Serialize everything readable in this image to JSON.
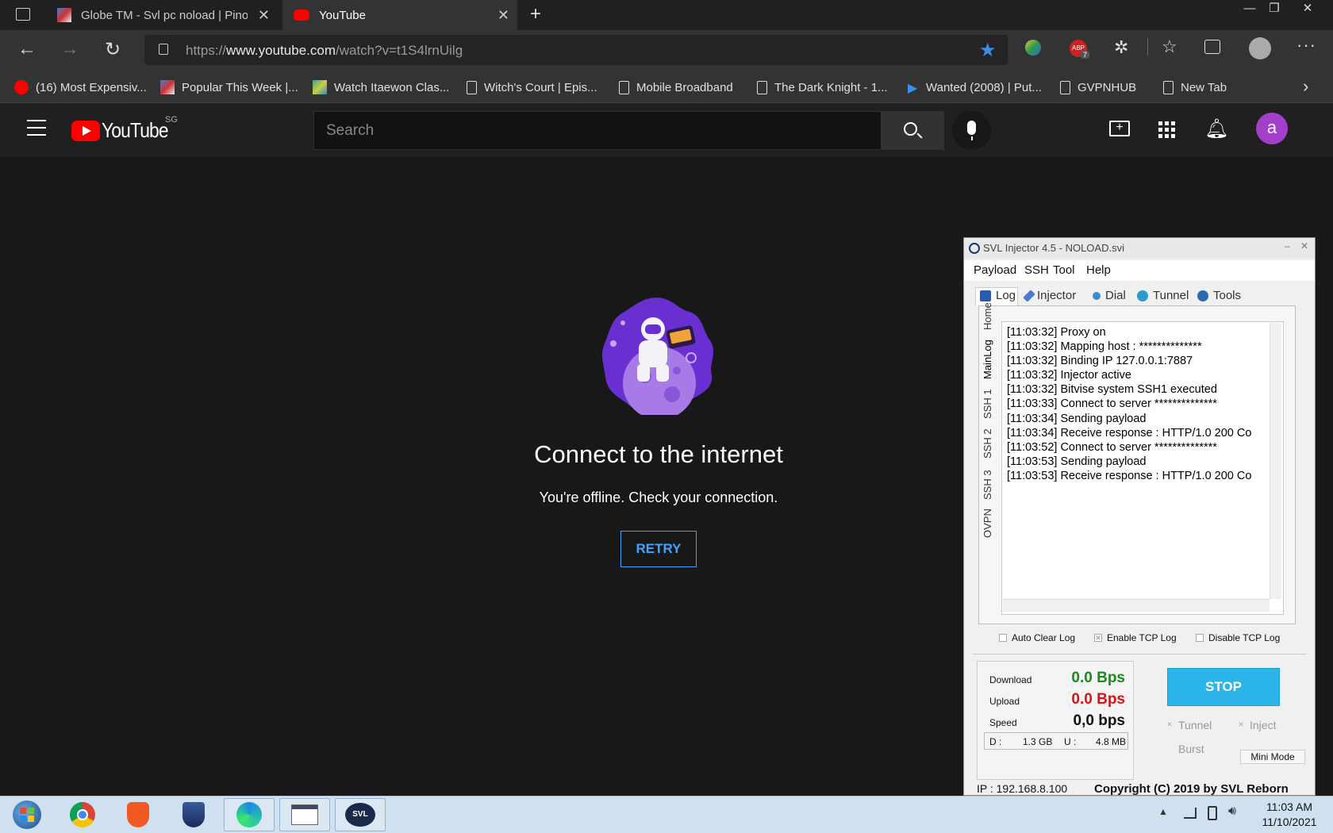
{
  "browser": {
    "tabs": [
      {
        "title": "Globe TM - Svl pc noload | Pinoy"
      },
      {
        "title": "YouTube"
      }
    ],
    "address": {
      "prefix": "https://",
      "host": "www.youtube.com",
      "path": "/watch?v=t1S4lrnUilg"
    },
    "bookmarks": [
      {
        "label": "(16) Most Expensiv..."
      },
      {
        "label": "Popular This Week |..."
      },
      {
        "label": "Watch Itaewon Clas..."
      },
      {
        "label": "Witch's Court | Epis..."
      },
      {
        "label": "Mobile Broadband"
      },
      {
        "label": "The Dark Knight - 1..."
      },
      {
        "label": "Wanted (2008) | Put..."
      },
      {
        "label": "GVPNHUB"
      },
      {
        "label": "New Tab"
      }
    ],
    "adblock_badge": "7"
  },
  "youtube": {
    "logo_text": "YouTube",
    "region": "SG",
    "search_placeholder": "Search",
    "avatar_letter": "a",
    "offline_title": "Connect to the internet",
    "offline_message": "You're offline. Check your connection.",
    "retry_label": "RETRY"
  },
  "svl": {
    "title": "SVL Injector 4.5 - NOLOAD.svi",
    "menu": [
      "Payload",
      "SSH",
      "Tool",
      "Help"
    ],
    "tabs": [
      "Log",
      "Injector",
      "Dial",
      "Tunnel",
      "Tools"
    ],
    "side_tabs": [
      "Home",
      "MainLog",
      "SSH 1",
      "SSH 2",
      "SSH 3",
      "OVPN"
    ],
    "log": [
      "[11:03:32] Proxy on",
      "[11:03:32] Mapping host : **************",
      "[11:03:32] Binding IP 127.0.0.1:7887",
      "[11:03:32] Injector active",
      "[11:03:32] Bitvise system SSH1 executed",
      "[11:03:33] Connect to server **************",
      "[11:03:34] Sending payload",
      "[11:03:34] Receive response : HTTP/1.0 200 Co",
      "[11:03:52] Connect to server **************",
      "[11:03:53] Sending payload",
      "[11:03:53] Receive response : HTTP/1.0 200 Co"
    ],
    "checkboxes": {
      "auto_clear": "Auto Clear Log",
      "enable_tcp": "Enable TCP Log",
      "disable_tcp": "Disable TCP Log"
    },
    "stats": {
      "download_label": "Download",
      "download_value": "0.0 Bps",
      "upload_label": "Upload",
      "upload_value": "0.0 Bps",
      "speed_label": "Speed",
      "speed_value": "0,0 bps",
      "d_label": "D :",
      "d_value": "1.3 GB",
      "u_label": "U :",
      "u_value": "4.8 MB"
    },
    "stop_label": "STOP",
    "options": {
      "tunnel": "Tunnel",
      "inject": "Inject",
      "burst": "Burst"
    },
    "mini_mode": "Mini Mode",
    "ip": "IP : 192.168.8.100",
    "copyright": "Copyright (C) 2019 by SVL Reborn",
    "colors": {
      "download": "#1a8a1a",
      "upload": "#e01010",
      "stop": "#2bb5e8"
    }
  },
  "taskbar": {
    "time": "11:03 AM",
    "date": "11/10/2021"
  }
}
